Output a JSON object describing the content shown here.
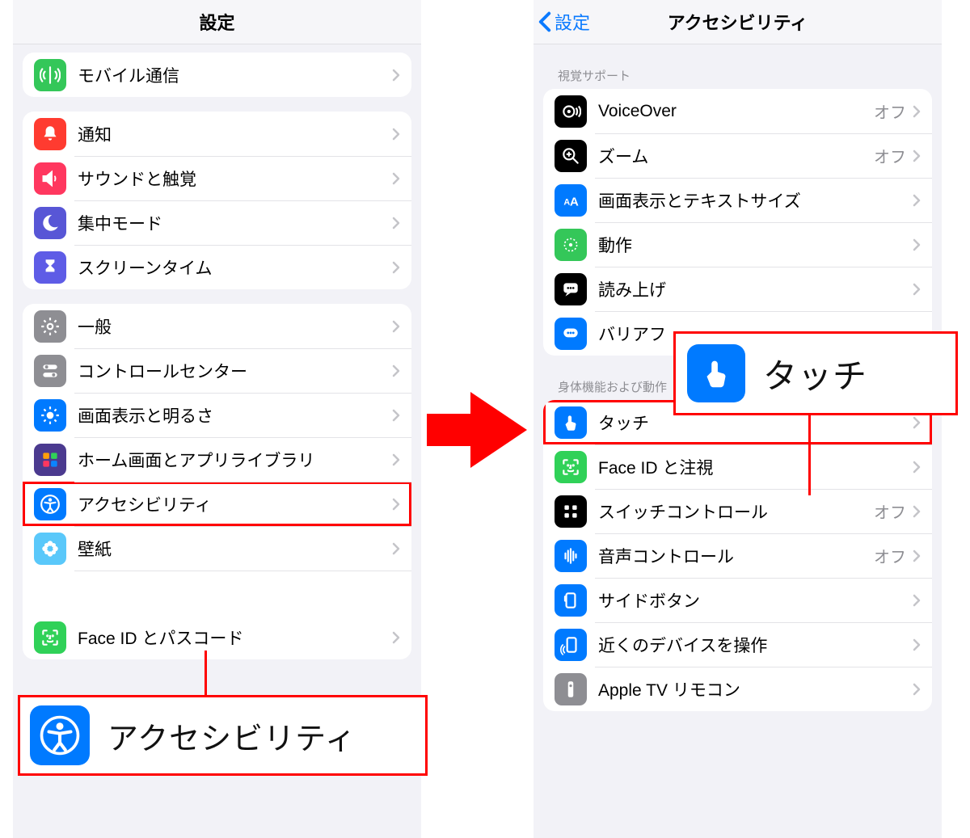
{
  "left": {
    "title": "設定",
    "group1": [
      {
        "id": "mobile",
        "label": "モバイル通信"
      }
    ],
    "group2": [
      {
        "id": "notifications",
        "label": "通知"
      },
      {
        "id": "sounds",
        "label": "サウンドと触覚"
      },
      {
        "id": "focus",
        "label": "集中モード"
      },
      {
        "id": "screentime",
        "label": "スクリーンタイム"
      }
    ],
    "group3": [
      {
        "id": "general",
        "label": "一般"
      },
      {
        "id": "controlcenter",
        "label": "コントロールセンター"
      },
      {
        "id": "display",
        "label": "画面表示と明るさ"
      },
      {
        "id": "homescreen",
        "label": "ホーム画面とアプリライブラリ"
      },
      {
        "id": "accessibility",
        "label": "アクセシビリティ"
      },
      {
        "id": "wallpaper",
        "label": "壁紙"
      },
      {
        "id": "siri",
        "label": ""
      },
      {
        "id": "faceid",
        "label": "Face ID とパスコード"
      }
    ],
    "callout": {
      "label": "アクセシビリティ"
    }
  },
  "right": {
    "back": "設定",
    "title": "アクセシビリティ",
    "section1_label": "視覚サポート",
    "section1": [
      {
        "id": "voiceover",
        "label": "VoiceOver",
        "value": "オフ"
      },
      {
        "id": "zoom",
        "label": "ズーム",
        "value": "オフ"
      },
      {
        "id": "textsize",
        "label": "画面表示とテキストサイズ",
        "value": ""
      },
      {
        "id": "motion",
        "label": "動作",
        "value": ""
      },
      {
        "id": "spoken",
        "label": "読み上げ",
        "value": ""
      },
      {
        "id": "barrier",
        "label": "バリアフ",
        "value": ""
      }
    ],
    "section2_label": "身体機能および動作",
    "section2": [
      {
        "id": "touch",
        "label": "タッチ",
        "value": ""
      },
      {
        "id": "faceid-attention",
        "label": "Face ID と注視",
        "value": ""
      },
      {
        "id": "switchcontrol",
        "label": "スイッチコントロール",
        "value": "オフ"
      },
      {
        "id": "voicecontrol",
        "label": "音声コントロール",
        "value": "オフ"
      },
      {
        "id": "sidebutton",
        "label": "サイドボタン",
        "value": ""
      },
      {
        "id": "nearbydevices",
        "label": "近くのデバイスを操作",
        "value": ""
      },
      {
        "id": "appletvremote",
        "label": "Apple TV リモコン",
        "value": ""
      }
    ],
    "callout": {
      "label": "タッチ"
    }
  }
}
